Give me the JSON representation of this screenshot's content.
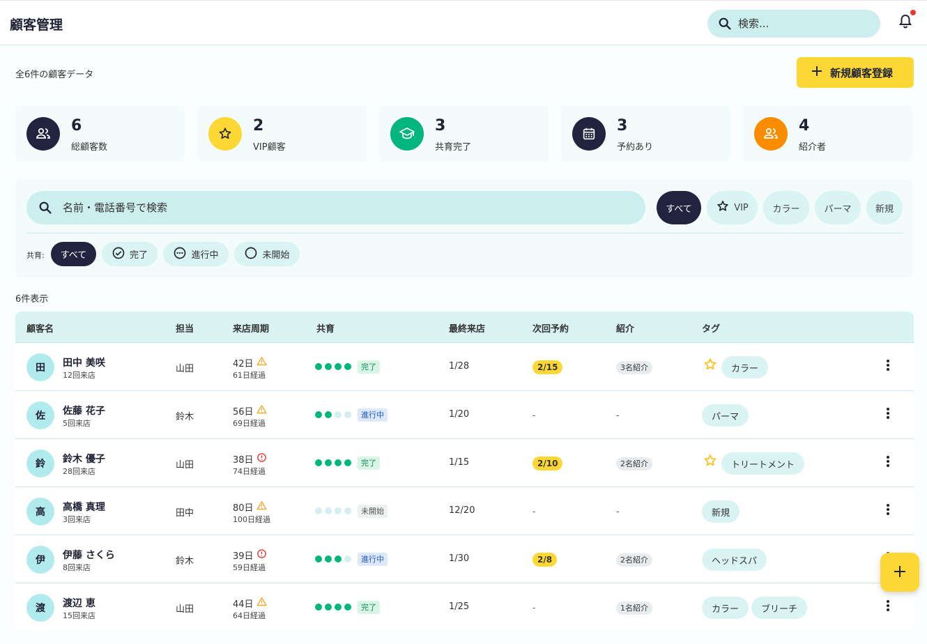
{
  "app": {
    "title": "顧客管理"
  },
  "header": {
    "search_placeholder": "検索..."
  },
  "summary": {
    "total_text": "全6件の顧客データ",
    "add_button": "新規顧客登録"
  },
  "stats": [
    {
      "value": "6",
      "label": "総顧客数",
      "icon": "people-icon",
      "color": "#23233f"
    },
    {
      "value": "2",
      "label": "VIP顧客",
      "icon": "star-icon",
      "color": "#fdd835"
    },
    {
      "value": "3",
      "label": "共育完了",
      "icon": "graduation-cap-icon",
      "color": "#00b67a"
    },
    {
      "value": "3",
      "label": "予約あり",
      "icon": "calendar-icon",
      "color": "#23233f"
    },
    {
      "value": "4",
      "label": "紹介者",
      "icon": "referral-icon",
      "color": "#fb8c00"
    }
  ],
  "filters": {
    "search_placeholder": "名前・電話番号で検索",
    "categories": [
      "すべて",
      "VIP",
      "カラー",
      "パーマ",
      "新規"
    ],
    "kyoiku_label": "共育:",
    "kyoiku": [
      "すべて",
      "完了",
      "進行中",
      "未開始"
    ]
  },
  "table": {
    "count_text": "6件表示",
    "headers": [
      "顧客名",
      "担当",
      "来店周期",
      "共育",
      "最終来店",
      "次回予約",
      "紹介",
      "タグ"
    ],
    "rows": [
      {
        "initial": "田",
        "name": "田中 美咲",
        "visits": "12回来店",
        "staff": "山田",
        "cycle": "42日",
        "cycle_alert": "warning",
        "elapsed": "61日経過",
        "progress": 4,
        "status": "完了",
        "last": "1/28",
        "next": "2/15",
        "referral": "3名紹介",
        "vip": true,
        "tags": [
          "カラー"
        ]
      },
      {
        "initial": "佐",
        "name": "佐藤 花子",
        "visits": "5回来店",
        "staff": "鈴木",
        "cycle": "56日",
        "cycle_alert": "warning",
        "elapsed": "69日経過",
        "progress": 2,
        "status": "進行中",
        "last": "1/20",
        "next": "-",
        "referral": "-",
        "vip": false,
        "tags": [
          "パーマ"
        ]
      },
      {
        "initial": "鈴",
        "name": "鈴木 優子",
        "visits": "28回来店",
        "staff": "山田",
        "cycle": "38日",
        "cycle_alert": "error",
        "elapsed": "74日経過",
        "progress": 4,
        "status": "完了",
        "last": "1/15",
        "next": "2/10",
        "referral": "2名紹介",
        "vip": true,
        "tags": [
          "トリートメント"
        ]
      },
      {
        "initial": "高",
        "name": "高橋 真理",
        "visits": "3回来店",
        "staff": "田中",
        "cycle": "80日",
        "cycle_alert": "warning",
        "elapsed": "100日経過",
        "progress": 0,
        "status": "未開始",
        "last": "12/20",
        "next": "-",
        "referral": "-",
        "vip": false,
        "tags": [
          "新規"
        ]
      },
      {
        "initial": "伊",
        "name": "伊藤 さくら",
        "visits": "8回来店",
        "staff": "鈴木",
        "cycle": "39日",
        "cycle_alert": "error",
        "elapsed": "59日経過",
        "progress": 3,
        "status": "進行中",
        "last": "1/30",
        "next": "2/8",
        "referral": "2名紹介",
        "vip": false,
        "tags": [
          "ヘッドスパ"
        ]
      },
      {
        "initial": "渡",
        "name": "渡辺 恵",
        "visits": "15回来店",
        "staff": "山田",
        "cycle": "44日",
        "cycle_alert": "warning",
        "elapsed": "64日経過",
        "progress": 4,
        "status": "完了",
        "last": "1/25",
        "next": "-",
        "referral": "1名紹介",
        "vip": false,
        "tags": [
          "カラー",
          "ブリーチ"
        ]
      }
    ]
  },
  "colors": {
    "accent": "#fdd835",
    "navy": "#23233f",
    "teal_light": "#daf3f3",
    "success": "#00b67a",
    "warning": "#f5a623",
    "error": "#e53935"
  }
}
